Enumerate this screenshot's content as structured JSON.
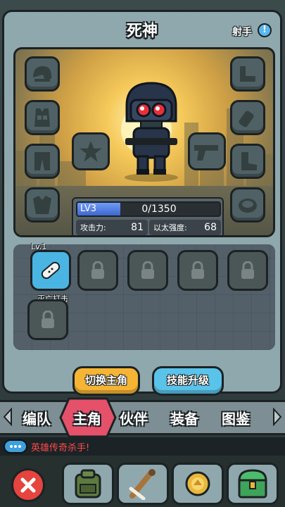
{
  "header": {
    "title": "死神",
    "class_label": "射手",
    "info_symbol": "!"
  },
  "level": {
    "label": "LV3",
    "xp_text": "0/1350",
    "fill_fraction": 0.3
  },
  "stats": [
    {
      "label": "攻击力:",
      "value": "81"
    },
    {
      "label": "以太强度:",
      "value": "68"
    }
  ],
  "skills": {
    "unlocked": {
      "level": "Lv.1",
      "name": "灭亡打击"
    },
    "locked_count": 5
  },
  "actions": {
    "switch_label": "切换主角",
    "upgrade_label": "技能升级"
  },
  "tabs": [
    "编队",
    "主角",
    "伙伴",
    "装备",
    "图鉴"
  ],
  "active_tab": "主角",
  "chat": {
    "message": "英雄传奇杀手!"
  },
  "icons": {
    "left_slots": [
      "helmet-icon",
      "vest-icon",
      "pants-icon",
      "backpack-icon"
    ],
    "right_slots": [
      "boomerang-icon",
      "grenade-icon",
      "boots-icon",
      "disc-icon"
    ]
  },
  "colors": {
    "accent_yellow": "#f6b434",
    "accent_blue": "#5ac3ea",
    "danger": "#e5443f",
    "active_tab": "#e5516a"
  }
}
